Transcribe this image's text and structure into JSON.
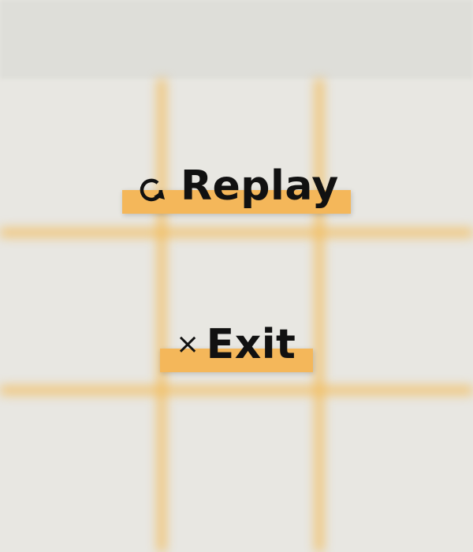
{
  "game": {
    "board": {
      "line_color": "#f3bb59",
      "background_color": "#e8e7e2"
    }
  },
  "menu": {
    "replay": {
      "label": "Replay",
      "icon": "replay-icon"
    },
    "exit": {
      "label": "Exit",
      "icon": "close-icon",
      "icon_glyph": "×"
    },
    "highlight_color": "#f4b75a"
  }
}
